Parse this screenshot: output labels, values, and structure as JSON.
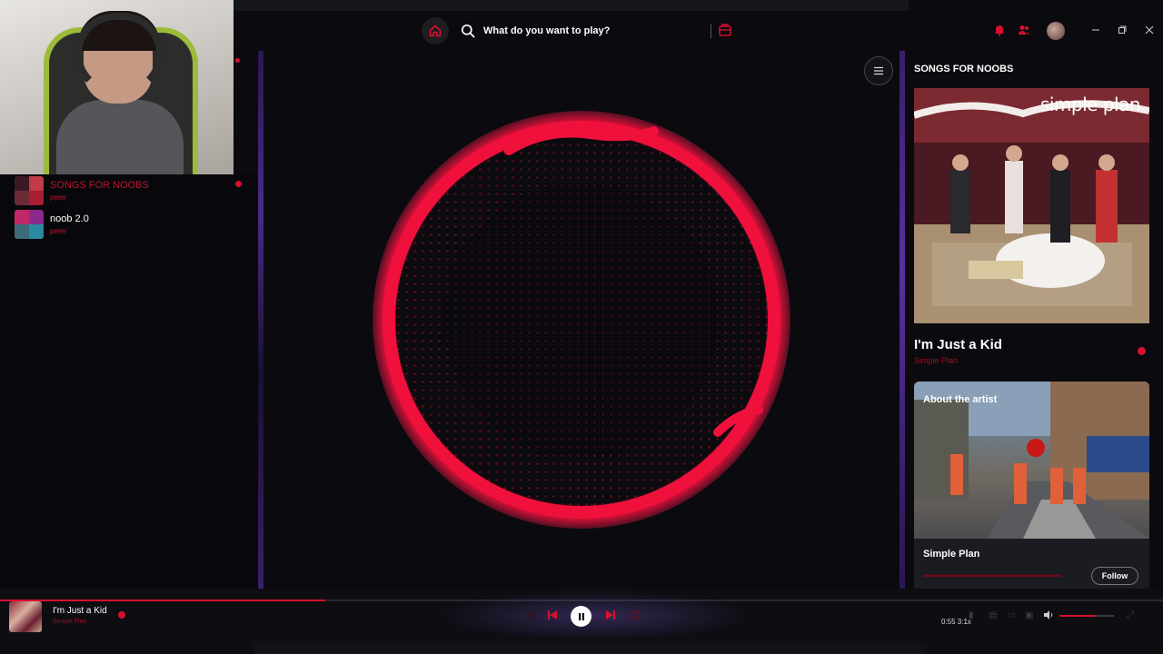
{
  "search": {
    "placeholder": "What do you want to play?"
  },
  "sidebar": {
    "items": [
      {
        "name": "SONGS FOR NOOBS",
        "owner": "peter"
      },
      {
        "name": "noob 2.0",
        "owner": "peter"
      }
    ]
  },
  "right_panel": {
    "title": "SONGS FOR NOOBS",
    "cover_text": "simple plan",
    "track_title": "I'm Just a Kid",
    "track_artist": "Simple Plan",
    "about_label": "About the artist",
    "artist_name": "Simple Plan",
    "follow_label": "Follow"
  },
  "player": {
    "title": "I'm Just a Kid",
    "artist": "Simple Plan",
    "time": "0:55 3:1x",
    "progress": 0.28,
    "volume": 0.65
  },
  "colors": {
    "accent": "#d8102e",
    "background": "#0a0a0f",
    "purple_edge": "#5a2fa0"
  },
  "icons": [
    "home-icon",
    "search-icon",
    "browse-icon",
    "bell-icon",
    "friends-icon",
    "minimize-icon",
    "maximize-icon",
    "close-icon",
    "menu-icon",
    "shuffle-icon",
    "previous-icon",
    "pause-icon",
    "next-icon",
    "repeat-icon",
    "volume-icon"
  ]
}
